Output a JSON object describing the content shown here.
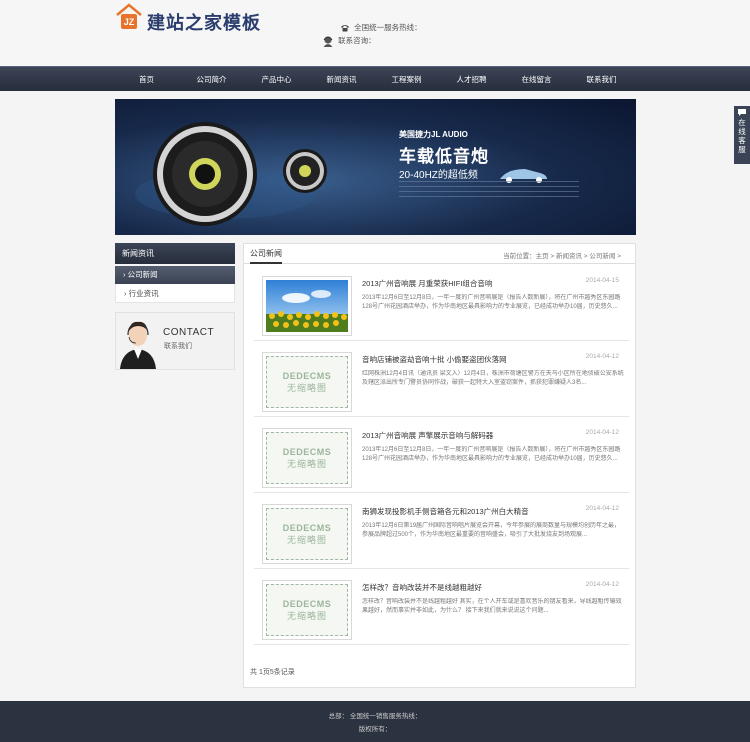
{
  "header": {
    "logo_badge": "JZ",
    "site_title": "建站之家模板",
    "hotline": "全国统一服务热线：",
    "consult": "联系咨询："
  },
  "nav": {
    "items": [
      "首页",
      "公司简介",
      "产品中心",
      "新闻资讯",
      "工程案例",
      "人才招聘",
      "在线留言",
      "联系我们"
    ]
  },
  "banner": {
    "line1": "美国捷力JL AUDIO",
    "line2": "车载低音炮",
    "line3": "20-40HZ的超低频"
  },
  "float_service": {
    "label": "在线客服"
  },
  "sidebar": {
    "title": "新闻资讯",
    "active_item": "公司新闻",
    "item": "行业资讯",
    "contact_title": "CONTACT",
    "contact_sub": "联系我们"
  },
  "main": {
    "title": "公司新闻",
    "breadcrumb": "当前位置：主页 > 新闻资讯 > 公司新闻 >",
    "pager": "共 1页5条记录",
    "articles": [
      {
        "title": "2013广州音响展 月重荣获HIFI组合音响",
        "date": "2014-04-15",
        "desc": "2013年12月6日至12月8日，一年一度的广州音响展是（报告人数新展），将在广州市越秀区东园路128号广州花园酒店举办，作为华南地区最具影响力的专业展览，已经成功举办10届，历史悠久..."
      },
      {
        "title": "音响店铺被盗劫音响十批 小偷娶盗团伙落网",
        "date": "2014-04-12",
        "desc": "红网株洲12月4日讯（通讯员 梁文入）12月4日，株洲市荷塘区警方在天马小区所在地侦破公安系统及辖区派出所专门警员协同作战，破获一起特大入室盗窃案件，抓获犯罪嫌疑人3名..."
      },
      {
        "title": "2013广州音响展 声擎展示音响与解码器",
        "date": "2014-04-12",
        "desc": "2013年12月6日至12月8日，一年一度的广州音响展是（报告人数新展），将在广州市越秀区东园路128号广州花园酒店举办，作为华南地区最具影响力的专业展览，已经成功举办10届，历史悠久..."
      },
      {
        "title": "南狮发现投影机手侧音箱各元和2013广州白大精音",
        "date": "2014-04-12",
        "desc": "2013年12月6日第19届广州国际音响唱片展览会开幕，今年参展的展商数量与规模均创历年之最，参展品牌超过500个，作为华南地区最重要的音响盛会，吸引了大批发烧友到场观展..."
      },
      {
        "title": "怎样改？音响改装并不是线越粗越好",
        "date": "2014-04-12",
        "desc": "怎样改？音响改装并不是线越粗越好 其实，在个人开车或是喜欢音乐的朋友看来，导线越粗传输效果越好，然而事实并非如此，为什么？ 接下来我们就来说说这个问题..."
      }
    ]
  },
  "footer": {
    "line1": "总部：  全国统一销售服务热线：",
    "line2": "版权所有："
  },
  "colors": {
    "nav_bg": "#2d3445",
    "footer_bg": "#2b3240",
    "logo_orange": "#e8742b",
    "title_blue": "#2a3d6d"
  }
}
